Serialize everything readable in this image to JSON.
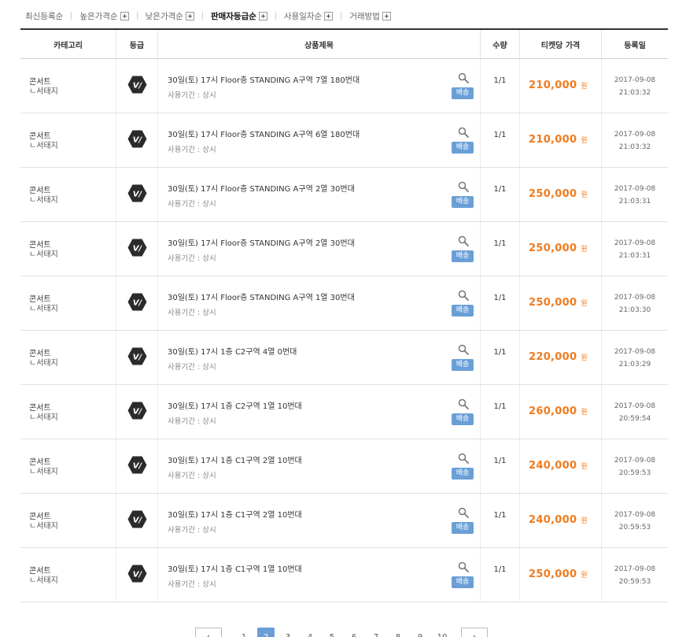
{
  "sort_options": [
    {
      "label": "최신등록순",
      "active": false,
      "has_plus": false
    },
    {
      "label": "높은가격순",
      "active": false,
      "has_plus": true
    },
    {
      "label": "낮은가격순",
      "active": false,
      "has_plus": true
    },
    {
      "label": "판매자등급순",
      "active": true,
      "has_plus": true
    },
    {
      "label": "사용일자순",
      "active": false,
      "has_plus": true
    },
    {
      "label": "거래방법",
      "active": false,
      "has_plus": true
    }
  ],
  "table": {
    "headers": {
      "category": "카테고리",
      "grade": "등급",
      "title": "상품제목",
      "qty": "수량",
      "price": "티켓당 가격",
      "date": "등록일"
    },
    "rows": [
      {
        "category": "콘서트",
        "subcategory": "ㄴ서태지",
        "grade_icon": "grade-v-icon",
        "title": "30일(토) 17시 Floor층 STANDING A구역 7열 180번대",
        "period": "사용기간 : 상시",
        "ship": "배송",
        "qty": "1/1",
        "price": "210,000",
        "won": "원",
        "date": "2017-09-08",
        "time": "21:03:32"
      },
      {
        "category": "콘서트",
        "subcategory": "ㄴ서태지",
        "grade_icon": "grade-v-icon",
        "title": "30일(토) 17시 Floor층 STANDING A구역 6열 180번대",
        "period": "사용기간 : 상시",
        "ship": "배송",
        "qty": "1/1",
        "price": "210,000",
        "won": "원",
        "date": "2017-09-08",
        "time": "21:03:32"
      },
      {
        "category": "콘서트",
        "subcategory": "ㄴ서태지",
        "grade_icon": "grade-v-icon",
        "title": "30일(토) 17시 Floor층 STANDING A구역 2열 30번대",
        "period": "사용기간 : 상시",
        "ship": "배송",
        "qty": "1/1",
        "price": "250,000",
        "won": "원",
        "date": "2017-09-08",
        "time": "21:03:31"
      },
      {
        "category": "콘서트",
        "subcategory": "ㄴ서태지",
        "grade_icon": "grade-v-icon",
        "title": "30일(토) 17시 Floor층 STANDING A구역 2열 30번대",
        "period": "사용기간 : 상시",
        "ship": "배송",
        "qty": "1/1",
        "price": "250,000",
        "won": "원",
        "date": "2017-09-08",
        "time": "21:03:31"
      },
      {
        "category": "콘서트",
        "subcategory": "ㄴ서태지",
        "grade_icon": "grade-v-icon",
        "title": "30일(토) 17시 Floor층 STANDING A구역 1열 30번대",
        "period": "사용기간 : 상시",
        "ship": "배송",
        "qty": "1/1",
        "price": "250,000",
        "won": "원",
        "date": "2017-09-08",
        "time": "21:03:30"
      },
      {
        "category": "콘서트",
        "subcategory": "ㄴ서태지",
        "grade_icon": "grade-v-icon",
        "title": "30일(토) 17시 1층 C2구역 4열 0번대",
        "period": "사용기간 : 상시",
        "ship": "배송",
        "qty": "1/1",
        "price": "220,000",
        "won": "원",
        "date": "2017-09-08",
        "time": "21:03:29"
      },
      {
        "category": "콘서트",
        "subcategory": "ㄴ서태지",
        "grade_icon": "grade-v-icon",
        "title": "30일(토) 17시 1층 C2구역 1열 10번대",
        "period": "사용기간 : 상시",
        "ship": "배송",
        "qty": "1/1",
        "price": "260,000",
        "won": "원",
        "date": "2017-09-08",
        "time": "20:59:54"
      },
      {
        "category": "콘서트",
        "subcategory": "ㄴ서태지",
        "grade_icon": "grade-v-icon",
        "title": "30일(토) 17시 1층 C1구역 2열 10번대",
        "period": "사용기간 : 상시",
        "ship": "배송",
        "qty": "1/1",
        "price": "240,000",
        "won": "원",
        "date": "2017-09-08",
        "time": "20:59:53"
      },
      {
        "category": "콘서트",
        "subcategory": "ㄴ서태지",
        "grade_icon": "grade-v-icon",
        "title": "30일(토) 17시 1층 C1구역 2열 10번대",
        "period": "사용기간 : 상시",
        "ship": "배송",
        "qty": "1/1",
        "price": "240,000",
        "won": "원",
        "date": "2017-09-08",
        "time": "20:59:53"
      },
      {
        "category": "콘서트",
        "subcategory": "ㄴ서태지",
        "grade_icon": "grade-v-icon",
        "title": "30일(토) 17시 1층 C1구역 1열 10번대",
        "period": "사용기간 : 상시",
        "ship": "배송",
        "qty": "1/1",
        "price": "250,000",
        "won": "원",
        "date": "2017-09-08",
        "time": "20:59:53"
      }
    ]
  },
  "pagination": {
    "prev_icon": "chevron-left-icon",
    "next_icon": "chevron-right-icon",
    "pages": [
      "1",
      "2",
      "3",
      "4",
      "5",
      "6",
      "7",
      "8",
      "9",
      "10"
    ],
    "current": "2"
  },
  "colors": {
    "price": "#f07b1d",
    "ship_badge": "#6a9fd6",
    "current_page": "#6a9fd6",
    "grade_badge": "#2b2b2b"
  }
}
